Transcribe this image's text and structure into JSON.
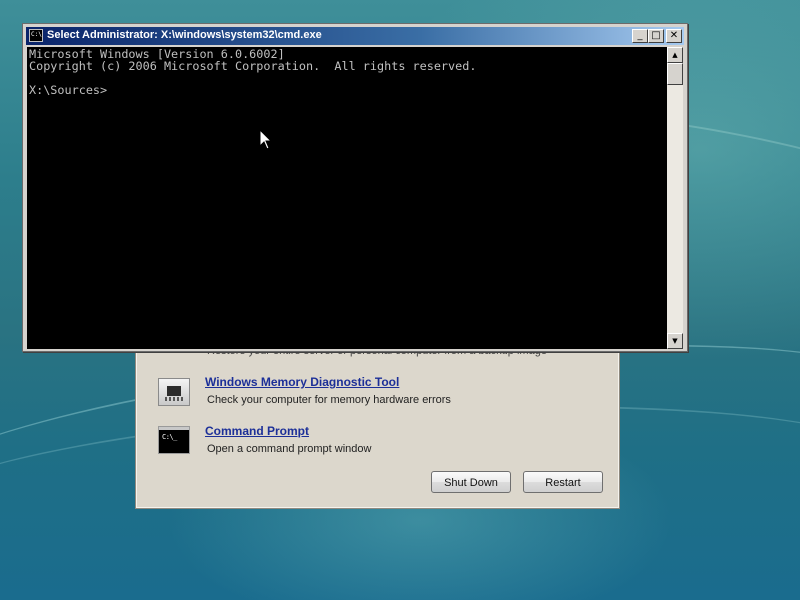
{
  "cmd_window": {
    "title": "Select Administrator: X:\\windows\\system32\\cmd.exe",
    "icon_text": "C:\\",
    "controls": {
      "minimize": "_",
      "maximize": "□",
      "close": "✕"
    },
    "console_lines": [
      "Microsoft Windows [Version 6.0.6002]",
      "Copyright (c) 2006 Microsoft Corporation.  All rights reserved.",
      "X:\\Sources>"
    ],
    "scrollbar": {
      "up": "▲",
      "down": "▼"
    }
  },
  "recovery_options": {
    "partial_option_desc": "Restore your entire server or personal computer from a backup image",
    "options": [
      {
        "title": "Windows Memory Diagnostic Tool",
        "description": "Check your computer for memory hardware errors",
        "icon": "memory-chip-icon"
      },
      {
        "title": "Command Prompt",
        "description": "Open a command prompt window",
        "icon": "command-prompt-icon",
        "icon_text": "C:\\_"
      }
    ],
    "buttons": {
      "shut_down": "Shut Down",
      "restart": "Restart"
    }
  },
  "colors": {
    "link": "#1c2f98",
    "console_bg": "#000000",
    "console_text": "#c0c0c0",
    "titlebar_start": "#0a246a"
  }
}
